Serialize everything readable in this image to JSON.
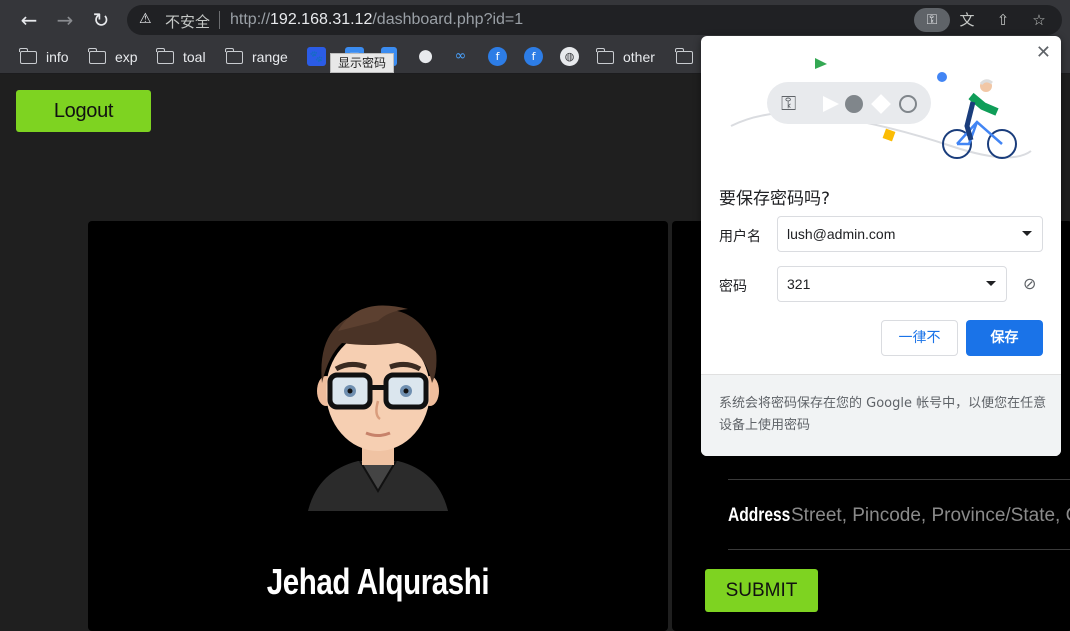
{
  "browser": {
    "insecure_label": "不安全",
    "url_prefix": "http://",
    "url_host": "192.168.31.12",
    "url_path": "/dashboard.php?id=1"
  },
  "bookmarks": {
    "items": [
      {
        "label": "info",
        "icon": "folder-icon"
      },
      {
        "label": "exp",
        "icon": "folder-icon"
      },
      {
        "label": "toal",
        "icon": "folder-icon"
      },
      {
        "label": "range",
        "icon": "folder-icon"
      },
      {
        "label": "other",
        "icon": "folder-icon"
      }
    ],
    "tooltip": "显示密码"
  },
  "page": {
    "logout_label": "Logout",
    "profile_name": "Jehad Alqurashi",
    "address_label": "Address",
    "address_placeholder": "Street, Pincode, Province/State, Co",
    "submit_label": "SUBMIT"
  },
  "save_password": {
    "title": "要保存密码吗?",
    "username_label": "用户名",
    "username_value": "lush@admin.com",
    "password_label": "密码",
    "password_value": "321",
    "never_label": "一律不",
    "save_label": "保存",
    "footer": "系统会将密码保存在您的 Google 帐号中，以便您在任意设备上使用密码"
  },
  "colors": {
    "accent_green": "#7ed321",
    "google_blue": "#1a73e8",
    "chrome_bar": "#35363a"
  }
}
